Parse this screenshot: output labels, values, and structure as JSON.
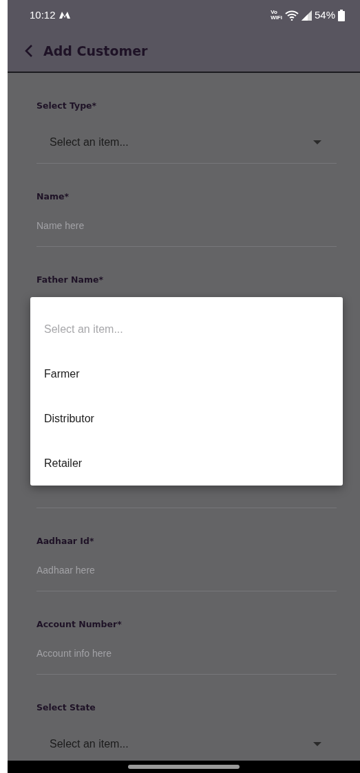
{
  "status_bar": {
    "time": "10:12",
    "vowifi": [
      "Vo",
      "WiFi"
    ],
    "battery": "54%"
  },
  "app_bar": {
    "title": "Add Customer"
  },
  "fields": [
    {
      "kind": "select",
      "label": "Select Type*",
      "value": "Select an item..."
    },
    {
      "kind": "text",
      "label": "Name*",
      "placeholder": "Name here"
    },
    {
      "kind": "covered",
      "label": "Father Name*"
    },
    {
      "kind": "text",
      "label": "Aadhaar Id*",
      "placeholder": "Aadhaar here"
    },
    {
      "kind": "text",
      "label": "Account Number*",
      "placeholder": "Account info here"
    },
    {
      "kind": "select",
      "label": "Select State",
      "value": "Select an item..."
    }
  ],
  "dropdown": {
    "placeholder": "Select an item...",
    "options": [
      "Farmer",
      "Distributor",
      "Retailer"
    ]
  }
}
